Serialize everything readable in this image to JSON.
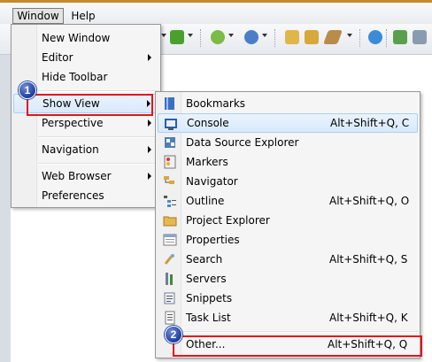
{
  "menubar": {
    "items": [
      {
        "label": "Window"
      },
      {
        "label": "Help"
      }
    ]
  },
  "window_menu": {
    "items": [
      {
        "label": "New Window"
      },
      {
        "label": "Editor"
      },
      {
        "label": "Hide Toolbar"
      },
      {
        "label": "Show View"
      },
      {
        "label": "Perspective"
      },
      {
        "label": "Navigation"
      },
      {
        "label": "Web Browser"
      },
      {
        "label": "Preferences"
      }
    ]
  },
  "show_view_menu": {
    "items": [
      {
        "label": "Bookmarks",
        "accel": ""
      },
      {
        "label": "Console",
        "accel": "Alt+Shift+Q, C"
      },
      {
        "label": "Data Source Explorer",
        "accel": ""
      },
      {
        "label": "Markers",
        "accel": ""
      },
      {
        "label": "Navigator",
        "accel": ""
      },
      {
        "label": "Outline",
        "accel": "Alt+Shift+Q, O"
      },
      {
        "label": "Project Explorer",
        "accel": ""
      },
      {
        "label": "Properties",
        "accel": ""
      },
      {
        "label": "Search",
        "accel": "Alt+Shift+Q, S"
      },
      {
        "label": "Servers",
        "accel": ""
      },
      {
        "label": "Snippets",
        "accel": ""
      },
      {
        "label": "Task List",
        "accel": "Alt+Shift+Q, K"
      },
      {
        "label": "Other...",
        "accel": "Alt+Shift+Q, Q"
      }
    ]
  },
  "annotations": {
    "step1": "1",
    "step2": "2"
  },
  "colors": {
    "highlight_box": "#e3141b",
    "badge": "#1d3f9c",
    "menu_bg": "#f5f5f5"
  }
}
